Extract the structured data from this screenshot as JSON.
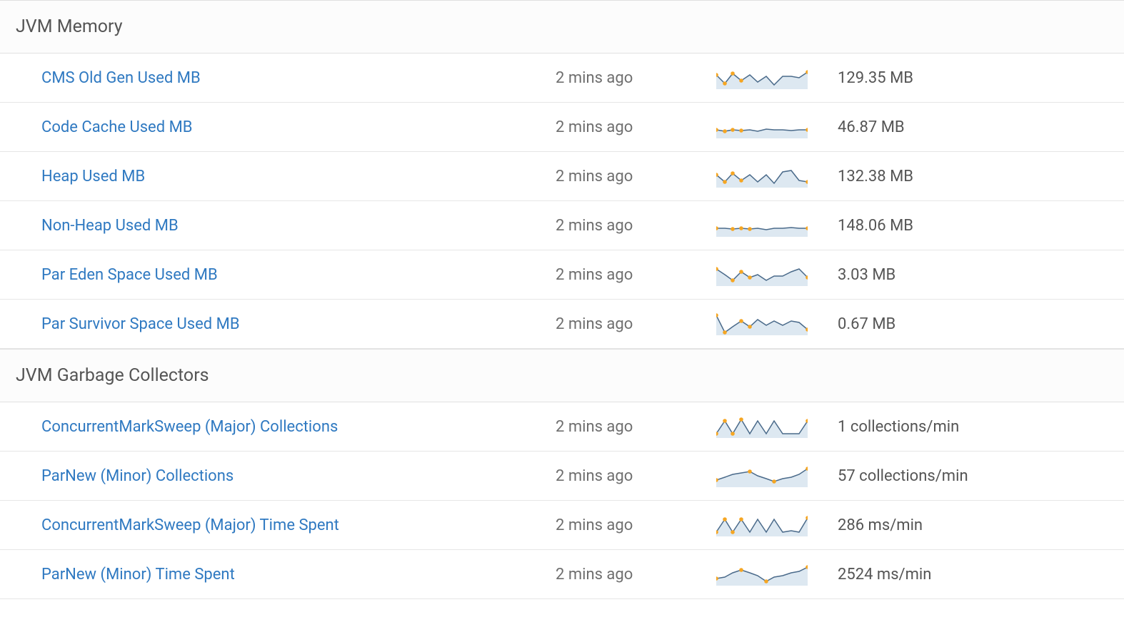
{
  "sections": [
    {
      "title": "JVM Memory",
      "rows": [
        {
          "name": "CMS Old Gen Used MB",
          "time": "2 mins ago",
          "value": "129.35 MB",
          "spark": [
            14,
            26,
            12,
            22,
            14,
            24,
            16,
            28,
            16,
            16,
            18,
            10
          ]
        },
        {
          "name": "Code Cache Used MB",
          "time": "2 mins ago",
          "value": "46.87 MB",
          "spark": [
            22,
            24,
            22,
            23,
            22,
            24,
            21,
            22,
            22,
            23,
            22,
            22
          ]
        },
        {
          "name": "Heap Used MB",
          "time": "2 mins ago",
          "value": "132.38 MB",
          "spark": [
            16,
            26,
            14,
            24,
            16,
            26,
            16,
            28,
            12,
            10,
            24,
            26
          ]
        },
        {
          "name": "Non-Heap Used MB",
          "time": "2 mins ago",
          "value": "148.06 MB",
          "spark": [
            22,
            22,
            23,
            22,
            23,
            22,
            24,
            22,
            22,
            21,
            22,
            22
          ]
        },
        {
          "name": "Par Eden Space Used MB",
          "time": "2 mins ago",
          "value": "3.03 MB",
          "spark": [
            10,
            18,
            26,
            14,
            22,
            18,
            26,
            20,
            20,
            14,
            10,
            22
          ]
        },
        {
          "name": "Par Survivor Space Used MB",
          "time": "2 mins ago",
          "value": "0.67 MB",
          "spark": [
            6,
            30,
            22,
            14,
            22,
            12,
            20,
            14,
            20,
            14,
            16,
            26
          ]
        }
      ]
    },
    {
      "title": "JVM Garbage Collectors",
      "rows": [
        {
          "name": "ConcurrentMarkSweep (Major) Collections",
          "time": "2 mins ago",
          "value": "1 collections/min",
          "spark": [
            28,
            10,
            28,
            8,
            28,
            10,
            28,
            10,
            28,
            28,
            28,
            10
          ]
        },
        {
          "name": "ParNew (Minor) Collections",
          "time": "2 mins ago",
          "value": "57 collections/min",
          "spark": [
            24,
            20,
            16,
            14,
            12,
            18,
            22,
            26,
            22,
            20,
            16,
            8
          ]
        },
        {
          "name": "ConcurrentMarkSweep (Major) Time Spent",
          "time": "2 mins ago",
          "value": "286 ms/min",
          "spark": [
            28,
            10,
            28,
            10,
            28,
            10,
            28,
            10,
            28,
            26,
            28,
            8
          ]
        },
        {
          "name": "ParNew (Minor) Time Spent",
          "time": "2 mins ago",
          "value": "2524 ms/min",
          "spark": [
            24,
            22,
            16,
            12,
            16,
            20,
            28,
            22,
            20,
            16,
            14,
            8
          ]
        }
      ]
    }
  ]
}
